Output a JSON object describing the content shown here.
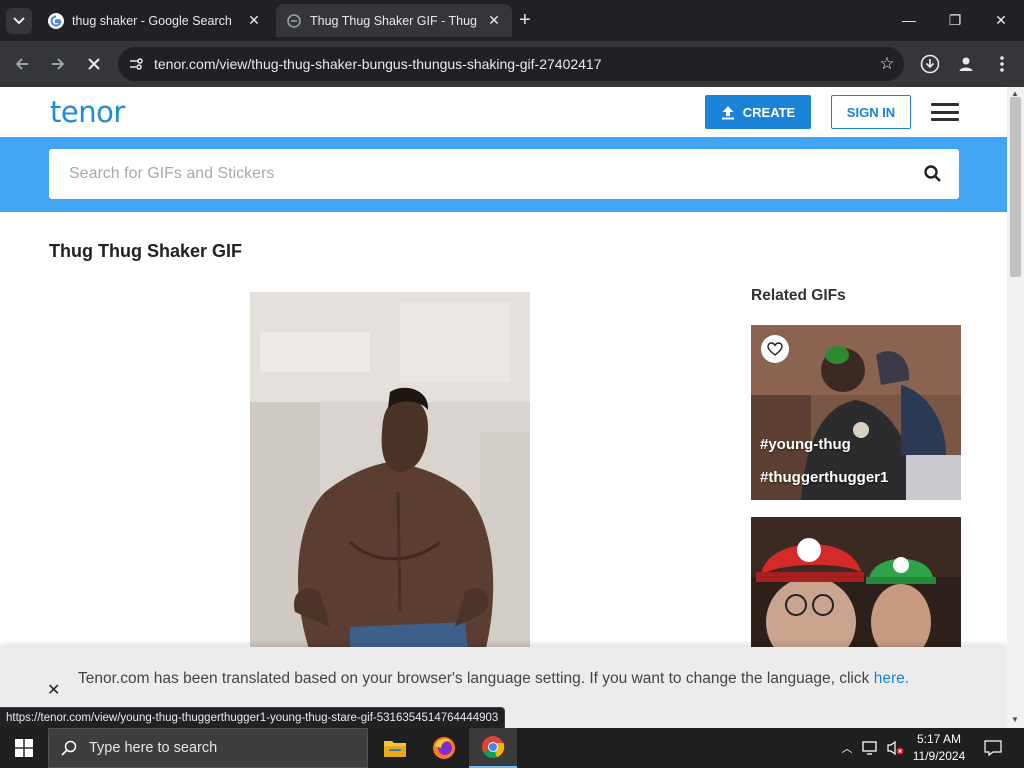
{
  "browser": {
    "tabs": [
      {
        "title": "thug shaker - Google Search",
        "active": false
      },
      {
        "title": "Thug Thug Shaker GIF - Thug Thug",
        "active": true
      }
    ],
    "new_tab": "+",
    "close_glyph": "✕",
    "url": "tenor.com/view/thug-thug-shaker-bungus-thungus-shaking-gif-27402417",
    "window_controls": {
      "minimize": "—",
      "restore": "❐",
      "close": "✕"
    }
  },
  "header": {
    "logo": "tenor",
    "create_label": "CREATE",
    "signin_label": "SIGN IN"
  },
  "search": {
    "placeholder": "Search for GIFs and Stickers"
  },
  "main": {
    "title": "Thug Thug Shaker GIF"
  },
  "related": {
    "title": "Related GIFs",
    "cards": [
      {
        "tags": [
          "#young-thug",
          "#thuggerthugger1"
        ]
      },
      {
        "tags": []
      }
    ]
  },
  "translation_banner": {
    "close": "✕",
    "message": "Tenor.com has been translated based on your browser's language setting. If you want to change the language, click",
    "link": "here."
  },
  "status_bar": {
    "url": "https://tenor.com/view/young-thug-thuggerthugger1-young-thug-stare-gif-5316354514764444903"
  },
  "taskbar": {
    "search_placeholder": "Type here to search",
    "time": "5:17 AM",
    "date": "11/9/2024"
  },
  "colors": {
    "tenor_blue": "#1a8ed4",
    "search_band": "#42a5f5",
    "create_button": "#1a83d8"
  }
}
